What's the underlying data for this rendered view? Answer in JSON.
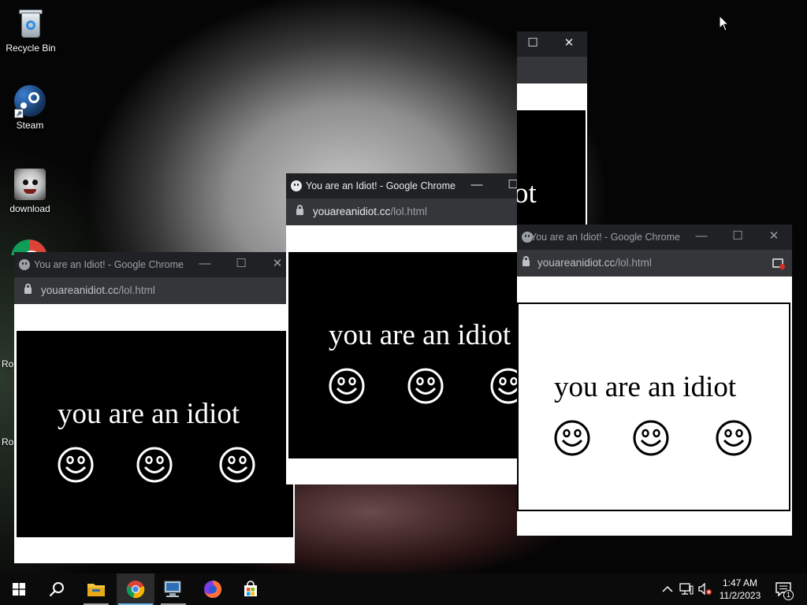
{
  "desktop": {
    "icons": [
      {
        "label": "Recycle Bin",
        "icon": "recycle-bin-icon"
      },
      {
        "label": "Steam",
        "icon": "steam-icon"
      },
      {
        "label": "download",
        "icon": "face-image-icon"
      }
    ],
    "partial_labels": [
      "Ro",
      "Ro"
    ]
  },
  "windows": [
    {
      "title": "You are an Idiot! - Google Chrome",
      "url_host": "youareanidiot.cc",
      "url_path": "/lol.html",
      "phrase": "you are an idiot",
      "theme": "dark"
    },
    {
      "title": "You are an Idiot! - Google Chrome",
      "url_host": "youareanidiot.cc",
      "url_path": "/lol.html",
      "phrase": "you are an idiot",
      "theme": "dark"
    },
    {
      "title": "You are an Idiot! - Google Chrome",
      "url_host": "youareanidiot.cc",
      "url_path": "/lol.html",
      "phrase": "you are an idiot",
      "theme": "light"
    },
    {
      "title": "",
      "phrase": "ot",
      "theme": "dark"
    }
  ],
  "window_controls": {
    "minimize": "—",
    "maximize": "☐",
    "close": "✕"
  },
  "taskbar": {
    "items": [
      "start-icon",
      "search-icon",
      "file-explorer-icon",
      "chrome-icon",
      "network-computer-icon",
      "firefox-icon",
      "store-icon"
    ],
    "active_item": "chrome-icon",
    "clock": {
      "time": "1:47 AM",
      "date": "11/2/2023"
    },
    "notification_count": "1"
  },
  "colors": {
    "titlebar": "#202124",
    "addressbar": "#35363a",
    "accent": "#76b9ed"
  }
}
